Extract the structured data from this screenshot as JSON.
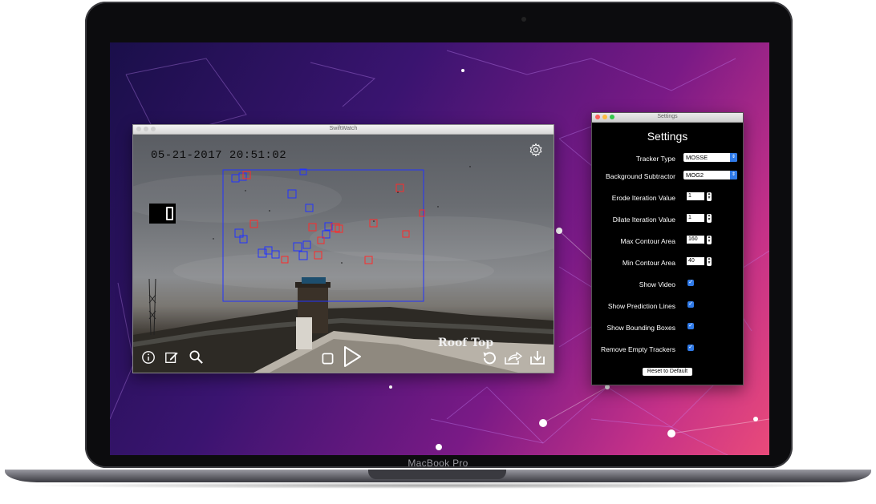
{
  "device_label": "MacBook Pro",
  "colors": {
    "accent": "#2f7ae8",
    "tracker_box_blue": "#2233ff",
    "tracker_box_red": "#ff2a2a"
  },
  "swiftwatch": {
    "window_title": "SwiftWatch",
    "timestamp": "05-21-2017 20:51:02",
    "camera_label": "Roof Top",
    "toolbar": {
      "info": "info-icon",
      "edit": "edit-icon",
      "search": "search-icon",
      "stop": "stop-icon",
      "play": "play-icon",
      "reset": "rotate-icon",
      "share": "share-icon",
      "download": "download-icon",
      "settings": "gear-icon"
    }
  },
  "settings": {
    "window_title": "Settings",
    "heading": "Settings",
    "tracker_type": {
      "label": "Tracker Type",
      "value": "MOSSE"
    },
    "background_subtractor": {
      "label": "Background Subtractor",
      "value": "MOG2"
    },
    "erode_iteration": {
      "label": "Erode Iteration Value",
      "value": "1"
    },
    "dilate_iteration": {
      "label": "Dilate Iteration Value",
      "value": "1"
    },
    "max_contour": {
      "label": "Max Contour Area",
      "value": "160"
    },
    "min_contour": {
      "label": "Min Contour Area",
      "value": "40"
    },
    "show_video": {
      "label": "Show Video",
      "checked": true
    },
    "show_prediction_lines": {
      "label": "Show Prediction Lines",
      "checked": true
    },
    "show_bounding_boxes": {
      "label": "Show Bounding Boxes",
      "checked": true
    },
    "remove_empty_trackers": {
      "label": "Remove Empty Trackers",
      "checked": true
    },
    "reset_button": "Reset to Default"
  }
}
